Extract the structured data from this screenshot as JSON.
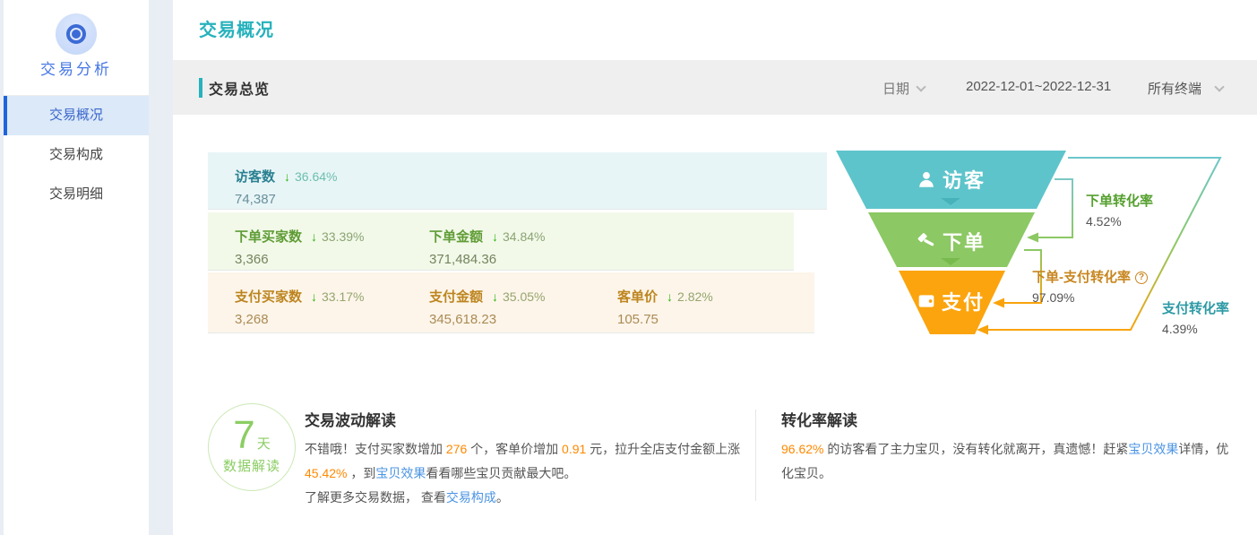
{
  "colors": {
    "accent_teal": "#26b2bc",
    "sidebar_active_blue": "#1e64dd",
    "funnel_visitor": "#5ec4cb",
    "funnel_order": "#8cc863",
    "funnel_pay": "#fba40e",
    "highlight_orange": "#ff8800",
    "link_blue": "#4b94e3",
    "decrease_arrow_green": "#2db40b"
  },
  "icons": {
    "down_arrow": "↓",
    "help": "?"
  },
  "sidebar": {
    "title": "交易分析",
    "items": [
      {
        "label": "交易概况",
        "active": true
      },
      {
        "label": "交易构成",
        "active": false
      },
      {
        "label": "交易明细",
        "active": false
      }
    ]
  },
  "page_title": "交易概况",
  "overview": {
    "title": "交易总览",
    "filters": {
      "dimension": "日期",
      "range": "2022-12-01~2022-12-31",
      "terminal": "所有终端"
    },
    "metric_rows": [
      {
        "cells": [
          {
            "label": "访客数",
            "delta": "36.64%",
            "value": "74,387"
          }
        ]
      },
      {
        "cells": [
          {
            "label": "下单买家数",
            "delta": "33.39%",
            "value": "3,366"
          },
          {
            "label": "下单金额",
            "delta": "34.84%",
            "value": "371,484.36"
          }
        ]
      },
      {
        "cells": [
          {
            "label": "支付买家数",
            "delta": "33.17%",
            "value": "3,268"
          },
          {
            "label": "支付金额",
            "delta": "35.05%",
            "value": "345,618.23"
          },
          {
            "label": "客单价",
            "delta": "2.82%",
            "value": "105.75"
          }
        ]
      }
    ]
  },
  "funnel": {
    "stages": [
      {
        "label": "访客"
      },
      {
        "label": "下单"
      },
      {
        "label": "支付"
      }
    ],
    "rates": [
      {
        "label": "下单转化率",
        "value": "4.52%"
      },
      {
        "label": "下单-支付转化率",
        "value": "97.09%"
      },
      {
        "label": "支付转化率",
        "value": "4.39%"
      }
    ]
  },
  "insights": {
    "badge": {
      "number": "7",
      "unit": "天",
      "caption": "数据解读"
    },
    "fluctuation": {
      "title": "交易波动解读",
      "p1": [
        {
          "t": "不错哦！支付买家数增加 "
        },
        {
          "t": "276",
          "c": "orange"
        },
        {
          "t": " 个，客单价增加 "
        },
        {
          "t": "0.91",
          "c": "orange"
        },
        {
          "t": " 元，拉升全店支付金额上涨 "
        },
        {
          "t": "45.42%",
          "c": "orange"
        },
        {
          "t": " ，到"
        },
        {
          "t": "宝贝效果",
          "c": "link",
          "n": "item-effect-link"
        },
        {
          "t": "看看哪些宝贝贡献最大吧。"
        }
      ],
      "p2": [
        {
          "t": "了解更多交易数据， 查看"
        },
        {
          "t": "交易构成",
          "c": "link",
          "n": "trade-composition-link"
        },
        {
          "t": "。"
        }
      ]
    },
    "conversion": {
      "title": "转化率解读",
      "p1": [
        {
          "t": " 96.62%",
          "c": "orange"
        },
        {
          "t": " 的访客看了主力宝贝，没有转化就离开，真遗憾！赶紧"
        },
        {
          "t": "宝贝效果",
          "c": "link",
          "n": "item-effect-link"
        },
        {
          "t": "详情，优化宝贝。"
        }
      ]
    }
  }
}
